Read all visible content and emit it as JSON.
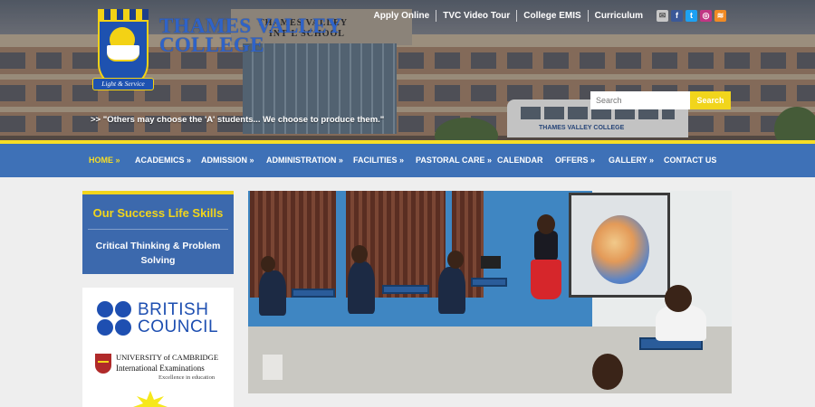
{
  "header": {
    "college_name_line1": "THAMES VALLEY",
    "college_name_line2": "COLLEGE",
    "crest_motto": "Light & Service",
    "school_sign_line1": "THAMES VALLEY",
    "school_sign_line2": "INT'L SCHOOL",
    "bus_text": "THAMES VALLEY COLLEGE",
    "tagline": ">>  \"Others may choose the 'A' students... We choose to produce them.\"",
    "top_links": [
      "Apply Online",
      "TVC Video Tour",
      "College EMIS",
      "Curriculum"
    ],
    "social_icons": [
      "email-icon",
      "facebook-icon",
      "twitter-icon",
      "instagram-icon",
      "rss-icon"
    ],
    "search": {
      "placeholder": "Search",
      "button_label": "Search"
    }
  },
  "nav": {
    "items": [
      {
        "label": "HOME »",
        "active": true
      },
      {
        "label": "ACADEMICS »"
      },
      {
        "label": "ADMISSION »"
      },
      {
        "label": "ADMINISTRATION »"
      },
      {
        "label": "FACILITIES »"
      },
      {
        "label": "PASTORAL CARE »"
      },
      {
        "label": "CALENDAR"
      },
      {
        "label": "OFFERS »"
      },
      {
        "label": "GALLERY »"
      },
      {
        "label": "CONTACT US"
      }
    ]
  },
  "sidebar": {
    "skills_title": "Our Success Life Skills",
    "skills_line1": "Critical Thinking & Problem",
    "skills_line2": "Solving",
    "british_council_line1": "BRITISH",
    "british_council_line2": "COUNCIL",
    "cambridge_line1": "UNIVERSITY of CAMBRIDGE",
    "cambridge_line2": "International Examinations",
    "cambridge_line3": "Excellence in education"
  },
  "colors": {
    "nav_blue": "#3e71b7",
    "accent_yellow": "#f2d51b",
    "british_council_blue": "#1e4fb1"
  }
}
